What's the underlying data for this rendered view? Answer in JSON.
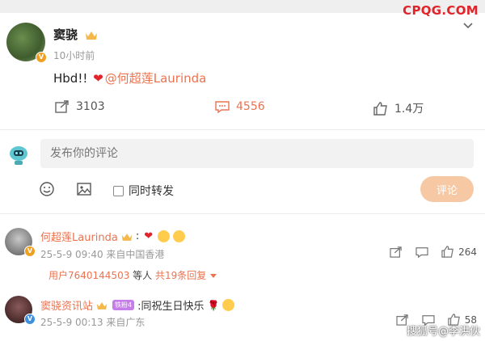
{
  "watermark": "CPQG.COM",
  "post": {
    "author": "窦骁",
    "time": "10小时前",
    "text_prefix": "Hbd!!",
    "heart": "❤",
    "mention": "@何超莲Laurinda",
    "shares": "3103",
    "comments": "4556",
    "likes": "1.4万"
  },
  "composer": {
    "placeholder": "发布你的评论",
    "repost_label": "同时转发",
    "submit_label": "评论"
  },
  "comments": [
    {
      "author": "何超莲Laurinda",
      "text": ":",
      "meta": "25-5-9 09:40 来自中国香港",
      "likes": "264",
      "replies": {
        "user": "用户7640144503",
        "mid": " 等人 ",
        "count": "共19条回复"
      }
    },
    {
      "author": "窦骁资讯站",
      "badge": "铁粉4",
      "text": ":同祝生日快乐",
      "meta": "25-5-9 00:13 来自广东",
      "likes": "58"
    }
  ],
  "footer_watermark": "搜狐号@李洪伙",
  "colors": {
    "accent": "#eb7350",
    "brand": "#e0242b",
    "submit_bg": "#f6c9a4"
  }
}
